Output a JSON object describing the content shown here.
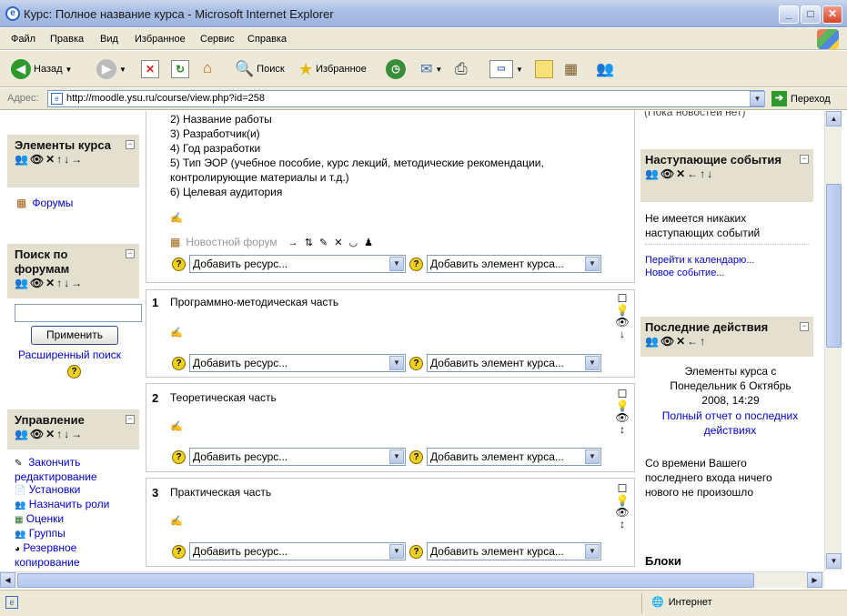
{
  "window": {
    "title": "Курс: Полное название курса - Microsoft Internet Explorer",
    "app_icon": "ie-icon"
  },
  "menu": [
    "Файл",
    "Правка",
    "Вид",
    "Избранное",
    "Сервис",
    "Справка"
  ],
  "toolbar": {
    "back": "Назад",
    "search": "Поиск",
    "favorites": "Избранное"
  },
  "address": {
    "label": "Адрес:",
    "url": "http://moodle.ysu.ru/course/view.php?id=258",
    "go": "Переход"
  },
  "left": {
    "elements": {
      "title": "Элементы курса",
      "icons": "👥👁✕↑↓→",
      "forum": "Форумы"
    },
    "search": {
      "title": "Поиск по форумам",
      "icons": "👥👁✕↑↓→",
      "input": "",
      "apply": "Применить",
      "advanced": "Расширенный поиск"
    },
    "admin": {
      "title": "Управление",
      "icons": "👥👁✕↑↓→",
      "items": [
        "Закончить редактирование",
        "Установки",
        "Назначить роли",
        "Оценки",
        "Группы",
        "Резервное копирование"
      ]
    }
  },
  "main": {
    "intro_lines": [
      "2) Название работы",
      "3) Разработчик(и)",
      "4) Год разработки",
      "5) Тип ЭОР (учебное пособие, курс лекций, методические рекомендации,",
      "контролирующие материалы и т.д.)",
      "6) Целевая аудитория"
    ],
    "news_forum": "Новостной форум",
    "news_icons": "→ ⇅ ✎ ✕ ◡ ♟",
    "add_resource": "Добавить ресурс...",
    "add_element": "Добавить элемент курса...",
    "sections": [
      {
        "num": "1",
        "title": "Программно-методическая часть"
      },
      {
        "num": "2",
        "title": "Теоретическая часть"
      },
      {
        "num": "3",
        "title": "Практическая часть"
      }
    ]
  },
  "right": {
    "news_top": "(Пока новостей нет)",
    "upcoming": {
      "title": "Наступающие события",
      "icons": "👥👁✕←↑↓",
      "text": "Не имеется никаких наступающих событий",
      "calendar": "Перейти к календарю...",
      "new_event": "Новое событие..."
    },
    "recent": {
      "title": "Последние действия",
      "icons": "👥👁✕←↑",
      "text1": "Элементы курса с Понедельник 6 Октябрь 2008, 14:29",
      "report": "Полный отчет о последних действиях",
      "text2": "Со времени Вашего последнего входа ничего нового не произошло"
    },
    "blocks": "Блоки"
  },
  "status": {
    "zone": "Интернет"
  }
}
